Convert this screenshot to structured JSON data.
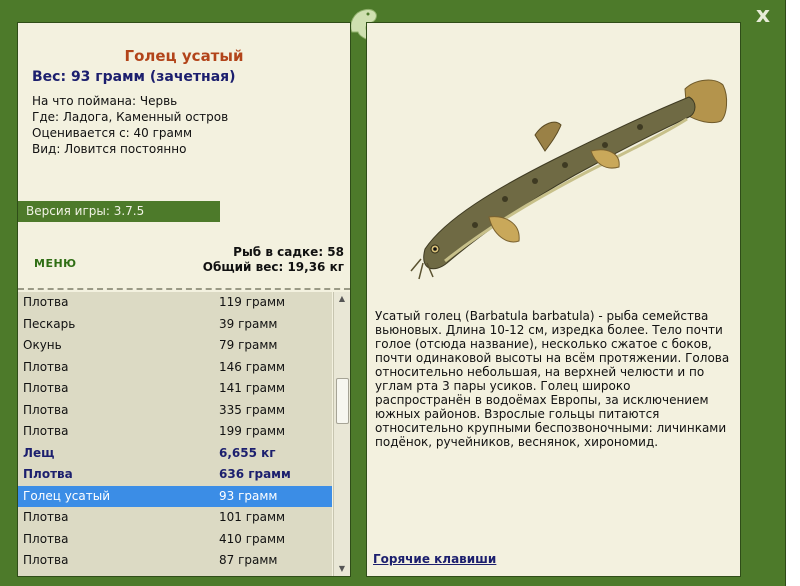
{
  "window": {
    "close_label": "x"
  },
  "fish": {
    "name": "Голец усатый",
    "weight_line": "Вес: 93 грамм (зачетная)",
    "bait_line": "На что поймана: Червь",
    "location_line": "Где: Ладога, Каменный остров",
    "valued_line": "Оценивается с: 40 грамм",
    "kind_line": "Вид: Ловится постоянно"
  },
  "version_label": "Версия игры: 3.7.5",
  "menu_label": "МЕНЮ",
  "stats": {
    "count_line": "Рыб в садке: 58",
    "total_line": "Общий вес: 19,36 кг"
  },
  "catch_list": [
    {
      "name": "Плотва",
      "weight": "119 грамм",
      "style": "normal"
    },
    {
      "name": "Пескарь",
      "weight": "39 грамм",
      "style": "normal"
    },
    {
      "name": "Окунь",
      "weight": "79 грамм",
      "style": "normal"
    },
    {
      "name": "Плотва",
      "weight": "146 грамм",
      "style": "normal"
    },
    {
      "name": "Плотва",
      "weight": "141 грамм",
      "style": "normal"
    },
    {
      "name": "Плотва",
      "weight": "335 грамм",
      "style": "normal"
    },
    {
      "name": "Плотва",
      "weight": "199 грамм",
      "style": "normal"
    },
    {
      "name": "Лещ",
      "weight": "6,655 кг",
      "style": "big"
    },
    {
      "name": "Плотва",
      "weight": "636 грамм",
      "style": "big"
    },
    {
      "name": "Голец усатый",
      "weight": "93 грамм",
      "style": "selected"
    },
    {
      "name": "Плотва",
      "weight": "101 грамм",
      "style": "normal"
    },
    {
      "name": "Плотва",
      "weight": "410 грамм",
      "style": "normal"
    },
    {
      "name": "Плотва",
      "weight": "87 грамм",
      "style": "normal"
    }
  ],
  "description": "Усатый голец (Barbatula barbatula) - рыба семейства вьюновых. Длина 10-12 см, изредка более. Тело почти голое (отсюда название), несколько сжатое с боков, почти одинаковой высоты на всём протяжении. Голова относительно небольшая, на верхней челюсти и по углам рта 3 пары усиков. Голец широко распространён в водоёмах Европы, за исключением южных районов. Взрослые гольцы питаются относительно крупными беспозвоночными: личинками подёнок, ручейников, веснянок, хирономид.",
  "hotkeys_label": "Горячие клавиши",
  "colors": {
    "frame_green": "#4d7a2a",
    "panel_bg": "#f3f1df",
    "title_orange": "#b2441a",
    "dark_blue": "#1c1f6e",
    "selection_blue": "#3b8de6"
  }
}
